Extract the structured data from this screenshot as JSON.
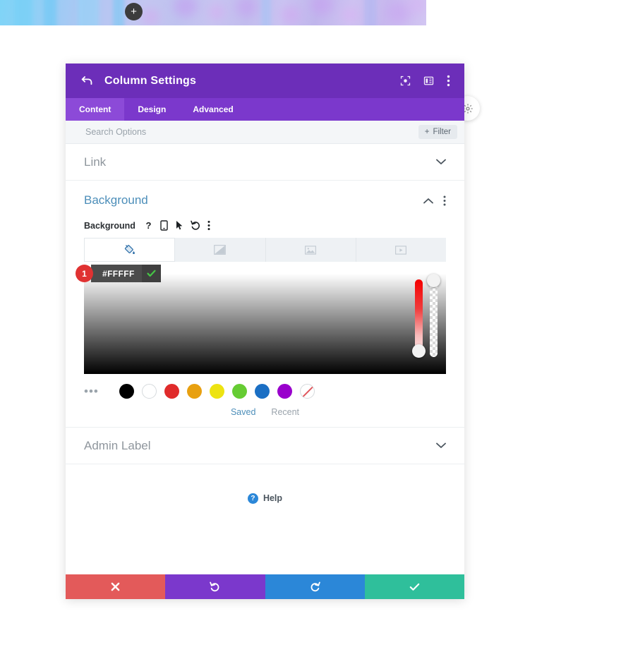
{
  "page": {
    "hero_alt": "blurred-blue-purple-floral-banner",
    "add_section_label": "+"
  },
  "modal": {
    "title": "Column Settings",
    "back_icon": "back-arrow-icon",
    "header_icons": [
      {
        "name": "focus-target-icon"
      },
      {
        "name": "layout-panel-icon"
      },
      {
        "name": "more-vertical-icon"
      }
    ],
    "tabs": [
      {
        "label": "Content",
        "active": true
      },
      {
        "label": "Design",
        "active": false
      },
      {
        "label": "Advanced",
        "active": false
      }
    ],
    "search": {
      "placeholder": "Search Options",
      "value": "",
      "filter_label": "Filter",
      "filter_plus": "+"
    },
    "sections": {
      "link": {
        "title": "Link",
        "expanded": false
      },
      "admin_label": {
        "title": "Admin Label",
        "expanded": false
      },
      "background": {
        "title": "Background",
        "expanded": true,
        "field_label": "Background",
        "field_icons": [
          {
            "name": "help-question-icon",
            "glyph": "?"
          },
          {
            "name": "responsive-phone-icon"
          },
          {
            "name": "hover-cursor-icon"
          },
          {
            "name": "reset-undo-icon"
          },
          {
            "name": "more-vertical-icon"
          }
        ],
        "type_tabs": [
          {
            "name": "background-color-tab",
            "icon": "paint-bucket-icon",
            "active": true
          },
          {
            "name": "background-gradient-tab",
            "icon": "gradient-icon",
            "active": false
          },
          {
            "name": "background-image-tab",
            "icon": "image-icon",
            "active": false
          },
          {
            "name": "background-video-tab",
            "icon": "video-icon",
            "active": false
          }
        ],
        "color_picker": {
          "badge_number": "1",
          "hex_value": "#FFFFFF",
          "confirm_icon": "checkmark-icon",
          "hue_slider_name": "hue-slider",
          "alpha_slider_name": "alpha-slider"
        },
        "swatches": {
          "more_glyph": "•••",
          "colors": [
            {
              "name": "swatch-black",
              "hex": "#000000"
            },
            {
              "name": "swatch-white",
              "hex": "#FFFFFF"
            },
            {
              "name": "swatch-red",
              "hex": "#E02B2B"
            },
            {
              "name": "swatch-orange",
              "hex": "#E8A010"
            },
            {
              "name": "swatch-yellow",
              "hex": "#EDE312"
            },
            {
              "name": "swatch-green",
              "hex": "#66CC33"
            },
            {
              "name": "swatch-blue",
              "hex": "#1B6FC4"
            },
            {
              "name": "swatch-purple",
              "hex": "#9900CC"
            },
            {
              "name": "swatch-none",
              "hex": "transparent"
            }
          ],
          "tabs": [
            {
              "label": "Saved",
              "active": true
            },
            {
              "label": "Recent",
              "active": false
            }
          ]
        }
      }
    },
    "help": {
      "label": "Help",
      "glyph": "?"
    },
    "footer": [
      {
        "name": "cancel-button",
        "icon": "close-x-icon",
        "color": "#e35a5a"
      },
      {
        "name": "undo-button",
        "icon": "undo-icon",
        "color": "#7b38cc"
      },
      {
        "name": "redo-button",
        "icon": "redo-icon",
        "color": "#2b87d8"
      },
      {
        "name": "save-button",
        "icon": "checkmark-icon",
        "color": "#2fbf9b"
      }
    ]
  }
}
